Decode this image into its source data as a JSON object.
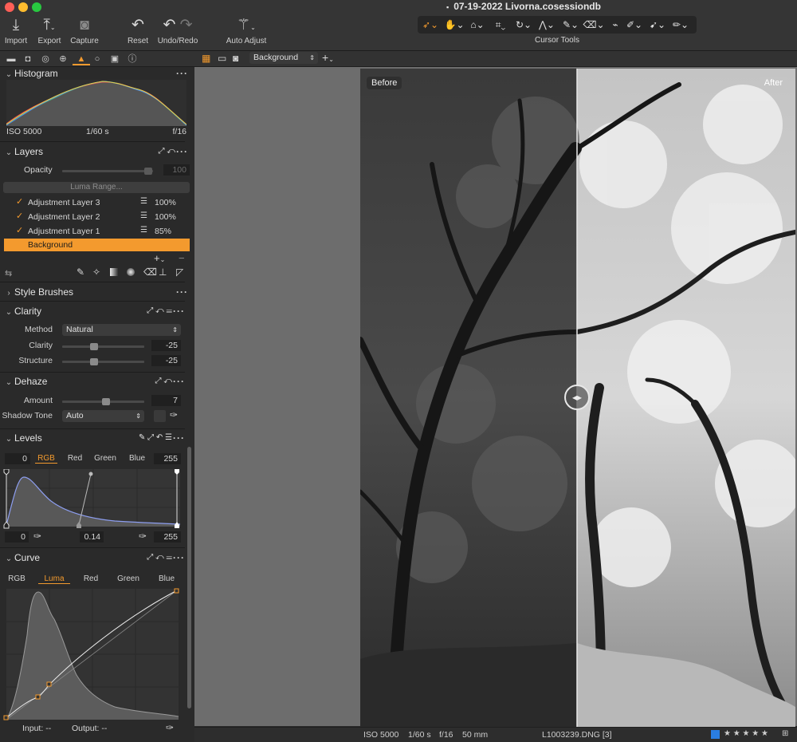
{
  "window": {
    "title": "07-19-2022 Livorna.cosessiondb"
  },
  "toolbar": {
    "import": "Import",
    "export": "Export",
    "capture": "Capture",
    "reset": "Reset",
    "undo_redo": "Undo/Redo",
    "auto_adjust": "Auto Adjust",
    "cursor_tools": "Cursor Tools"
  },
  "viewer_bar": {
    "layer_select": "Background"
  },
  "histogram": {
    "title": "Histogram",
    "iso": "ISO 5000",
    "shutter": "1/60 s",
    "aperture": "f/16"
  },
  "layers": {
    "title": "Layers",
    "opacity_label": "Opacity",
    "opacity_value": "100",
    "luma_range": "Luma Range...",
    "items": [
      {
        "name": "Adjustment Layer 3",
        "opacity": "100%"
      },
      {
        "name": "Adjustment Layer 2",
        "opacity": "100%"
      },
      {
        "name": "Adjustment Layer 1",
        "opacity": "85%"
      },
      {
        "name": "Background"
      }
    ]
  },
  "style_brushes": {
    "title": "Style Brushes"
  },
  "clarity": {
    "title": "Clarity",
    "method_label": "Method",
    "method_value": "Natural",
    "clarity_label": "Clarity",
    "clarity_value": "-25",
    "clarity_level": 0.4,
    "structure_label": "Structure",
    "structure_value": "-25",
    "structure_level": 0.4
  },
  "dehaze": {
    "title": "Dehaze",
    "amount_label": "Amount",
    "amount_value": "7",
    "amount_level": 0.54,
    "shadow_tone_label": "Shadow Tone",
    "shadow_tone_value": "Auto"
  },
  "levels": {
    "title": "Levels",
    "in_low": "0",
    "in_high": "255",
    "tabs": [
      "RGB",
      "Red",
      "Green",
      "Blue"
    ],
    "out_low": "0",
    "midpoint": "0.14",
    "out_high": "255"
  },
  "curve": {
    "title": "Curve",
    "tabs": [
      "RGB",
      "Luma",
      "Red",
      "Green",
      "Blue"
    ],
    "input_label": "Input:",
    "input_value": "--",
    "output_label": "Output:",
    "output_value": "--"
  },
  "viewer": {
    "before": "Before",
    "after": "After"
  },
  "status": {
    "iso": "ISO 5000",
    "shutter": "1/60 s",
    "aperture": "f/16",
    "focal": "50 mm",
    "filename": "L1003239.DNG [3]",
    "rating_stars": "★ ★ ★ ★ ★"
  },
  "colors": {
    "accent": "#f39a2e",
    "color_tag": "#2a7de1"
  }
}
